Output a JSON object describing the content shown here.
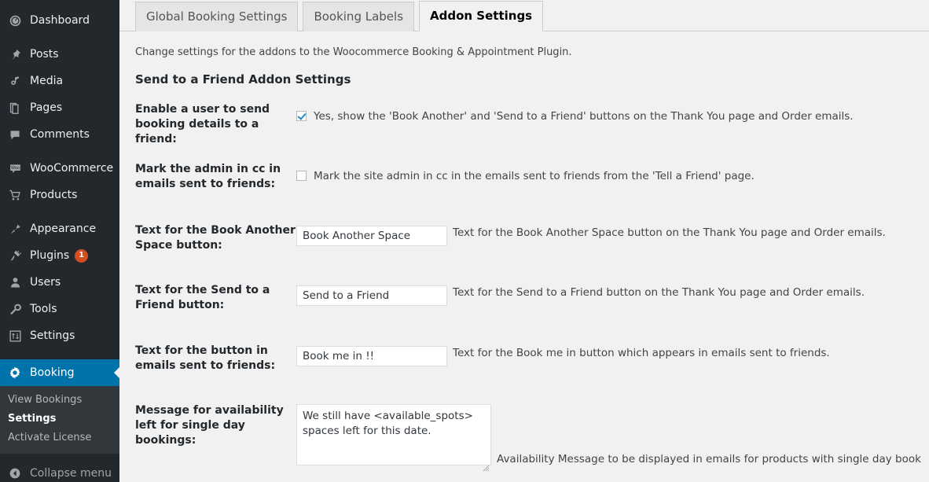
{
  "sidebar": {
    "items": [
      {
        "label": "Dashboard",
        "icon": "dashboard-icon",
        "name": "dashboard"
      },
      {
        "label": "Posts",
        "icon": "pin-icon",
        "name": "posts"
      },
      {
        "label": "Media",
        "icon": "media-icon",
        "name": "media"
      },
      {
        "label": "Pages",
        "icon": "pages-icon",
        "name": "pages"
      },
      {
        "label": "Comments",
        "icon": "comment-icon",
        "name": "comments"
      },
      {
        "label": "WooCommerce",
        "icon": "woocommerce-icon",
        "name": "woocommerce"
      },
      {
        "label": "Products",
        "icon": "cart-icon",
        "name": "products"
      },
      {
        "label": "Appearance",
        "icon": "brush-icon",
        "name": "appearance"
      },
      {
        "label": "Plugins",
        "icon": "plug-icon",
        "name": "plugins",
        "badge": "1"
      },
      {
        "label": "Users",
        "icon": "user-icon",
        "name": "users"
      },
      {
        "label": "Tools",
        "icon": "wrench-icon",
        "name": "tools"
      },
      {
        "label": "Settings",
        "icon": "sliders-icon",
        "name": "settings"
      },
      {
        "label": "Booking",
        "icon": "gear-icon",
        "name": "booking",
        "active": true
      }
    ],
    "submenu": [
      {
        "label": "View Bookings",
        "current": false
      },
      {
        "label": "Settings",
        "current": true
      },
      {
        "label": "Activate License",
        "current": false
      }
    ],
    "collapse_label": "Collapse menu",
    "collapse_icon": "collapse-arrow-icon",
    "colors": {
      "background": "#23282d",
      "submenu_background": "#32373c",
      "active": "#0073aa",
      "badge": "#d54e21"
    }
  },
  "tabs": [
    {
      "label": "Global Booking Settings",
      "active": false
    },
    {
      "label": "Booking Labels",
      "active": false
    },
    {
      "label": "Addon Settings",
      "active": true
    }
  ],
  "page": {
    "description": "Change settings for the addons to the Woocommerce Booking & Appointment Plugin.",
    "section_title": "Send to a Friend Addon Settings"
  },
  "form": {
    "rows": [
      {
        "name": "enable-send-booking-details",
        "label": "Enable a user to send booking details to a friend:",
        "type": "checkbox",
        "checked": true,
        "checkbox_label": "Yes, show the 'Book Another' and 'Send to a Friend' buttons on the Thank You page and Order emails."
      },
      {
        "name": "mark-admin-cc",
        "label": "Mark the admin in cc in emails sent to friends:",
        "type": "checkbox",
        "checked": false,
        "checkbox_label": "Mark the site admin in cc in the emails sent to friends from the 'Tell a Friend' page."
      },
      {
        "name": "book-another-space-text",
        "label": "Text for the Book Another Space button:",
        "type": "text",
        "value": "Book Another Space",
        "help": "Text for the Book Another Space button on the Thank You page and Order emails."
      },
      {
        "name": "send-to-a-friend-text",
        "label": "Text for the Send to a Friend button:",
        "type": "text",
        "value": "Send to a Friend",
        "help": "Text for the Send to a Friend button on the Thank You page and Order emails."
      },
      {
        "name": "email-button-text",
        "label": "Text for the button in emails sent to friends:",
        "type": "text",
        "value": "Book me in !!",
        "help": "Text for the Book me in button which appears in emails sent to friends."
      },
      {
        "name": "availability-message-single-day",
        "label": "Message for availability left for single day bookings:",
        "type": "textarea",
        "value": "We still have <available_spots> spaces left for this date.",
        "help": "Availability Message to be displayed in emails for products with single day book"
      }
    ]
  }
}
